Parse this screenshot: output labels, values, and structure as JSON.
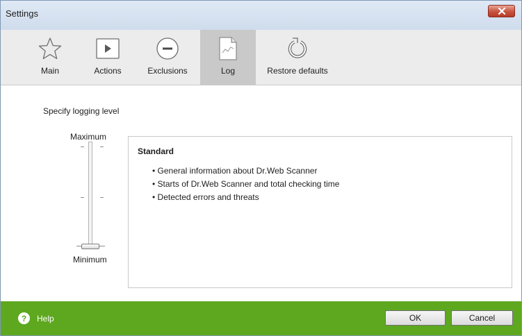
{
  "window": {
    "title": "Settings"
  },
  "toolbar": {
    "items": [
      {
        "label": "Main",
        "icon": "star-icon",
        "active": false
      },
      {
        "label": "Actions",
        "icon": "play-icon",
        "active": false
      },
      {
        "label": "Exclusions",
        "icon": "minus-circle-icon",
        "active": false
      },
      {
        "label": "Log",
        "icon": "log-document-icon",
        "active": true
      },
      {
        "label": "Restore defaults",
        "icon": "restore-arrow-icon",
        "active": false
      }
    ]
  },
  "log": {
    "heading": "Specify logging level",
    "slider": {
      "max_label": "Maximum",
      "min_label": "Minimum",
      "levels": 3,
      "selected_level": "minimum"
    },
    "description": {
      "title": "Standard",
      "items": [
        "General information about Dr.Web Scanner",
        "Starts of Dr.Web Scanner and total checking time",
        "Detected errors and threats"
      ]
    }
  },
  "footer": {
    "help_icon": "?",
    "help_label": "Help",
    "ok_label": "OK",
    "cancel_label": "Cancel"
  },
  "colors": {
    "footer_green": "#5da81f",
    "toolbar_bg": "#ececec",
    "active_tab_bg": "#c9c9c9",
    "close_red": "#c7533f"
  }
}
